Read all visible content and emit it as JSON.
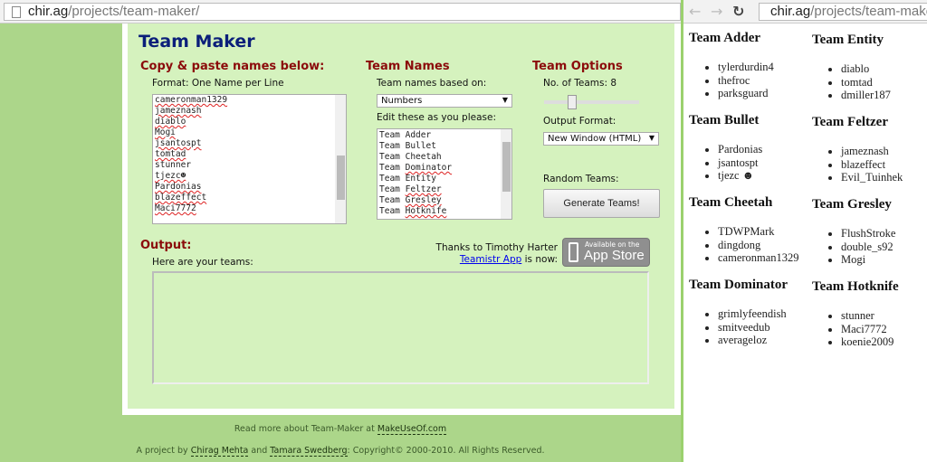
{
  "left_window": {
    "address": {
      "host": "chir.ag",
      "path": "/projects/team-maker/"
    },
    "title": "Team Maker",
    "names_section": {
      "heading": "Copy & paste names below:",
      "format_label": "Format: One Name per Line",
      "names": [
        "cameronman1329",
        "jameznash",
        "diablo",
        "Mogi",
        "jsantospt",
        "tomtad",
        "stunner",
        "tjezc☻",
        "Pardonias",
        "blazeffect",
        "Maci7772"
      ]
    },
    "team_names_section": {
      "heading": "Team Names",
      "based_on_label": "Team names based on:",
      "based_on_value": "Numbers",
      "edit_label": "Edit these as you please:",
      "names": [
        "Team Adder",
        "Team Bullet",
        "Team Cheetah",
        "Team Dominator",
        "Team Entity",
        "Team Feltzer",
        "Team Gresley",
        "Team Hotknife"
      ]
    },
    "options_section": {
      "heading": "Team Options",
      "teams_label": "No. of Teams: 8",
      "teams_value": 8,
      "output_format_label": "Output Format:",
      "output_format_value": "New Window (HTML)",
      "random_label": "Random Teams:",
      "generate_button": "Generate Teams!"
    },
    "output": {
      "heading": "Output:",
      "label": "Here are your teams:"
    },
    "thanks": {
      "line1": "Thanks to Timothy Harter",
      "link": "Teamistr App",
      "line2_suffix": " is now:",
      "badge_small": "Available on the",
      "badge_big": "App Store"
    },
    "footer": {
      "read_more": "Read more about Team-Maker at ",
      "read_more_link": "MakeUseOf.com",
      "project_by": "A project by ",
      "author1": "Chirag Mehta",
      "and": " and ",
      "author2": "Tamara Swedberg",
      "copyright": ": Copyright© 2000-2010. All Rights Reserved."
    }
  },
  "right_window": {
    "address": {
      "host": "chir.ag",
      "path": "/projects/team-maker/g"
    },
    "teams": [
      {
        "name": "Team Adder",
        "members": [
          "tylerdurdin4",
          "thefroc",
          "parksguard"
        ]
      },
      {
        "name": "Team Bullet",
        "members": [
          "Pardonias",
          "jsantospt",
          "tjezc ☻"
        ]
      },
      {
        "name": "Team Cheetah",
        "members": [
          "TDWPMark",
          "dingdong",
          "cameronman1329"
        ]
      },
      {
        "name": "Team Dominator",
        "members": [
          "grimlyfeendish",
          "smitveedub",
          "averageloz"
        ]
      },
      {
        "name": "Team Entity",
        "members": [
          "diablo",
          "tomtad",
          "dmiller187"
        ]
      },
      {
        "name": "Team Feltzer",
        "members": [
          "jameznash",
          "blazeffect",
          "Evil_Tuinhek"
        ]
      },
      {
        "name": "Team Gresley",
        "members": [
          "FlushStroke",
          "double_s92",
          "Mogi"
        ]
      },
      {
        "name": "Team Hotknife",
        "members": [
          "stunner",
          "Maci7772",
          "koenie2009"
        ]
      }
    ]
  }
}
